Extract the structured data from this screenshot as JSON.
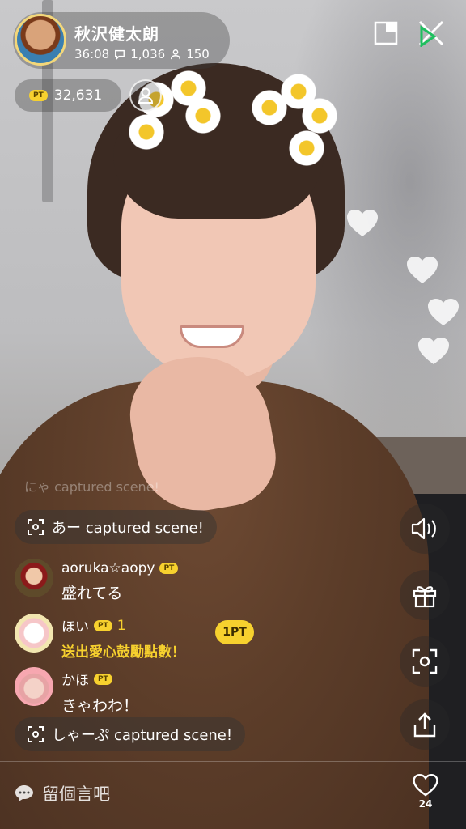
{
  "host": {
    "name": "秋沢健太朗",
    "duration": "36:08",
    "comment_count": "1,036",
    "viewer_count": "150"
  },
  "points": {
    "badge": "PT",
    "value": "32,631"
  },
  "scene_captures": [
    {
      "text": "あー captured scene!"
    },
    {
      "text": "しゃーぷ captured scene!"
    }
  ],
  "faded_message": "にゃ captured scene!",
  "comments": [
    {
      "user": "aoruka☆aopy",
      "badge": "PT",
      "count": "",
      "text": "盛れてる"
    },
    {
      "user": "ほい",
      "badge": "PT",
      "count": "1",
      "text": "送出愛心鼓勵點數！"
    },
    {
      "user": "かほ",
      "badge": "PT",
      "count": "",
      "text": "きゃわわ！"
    }
  ],
  "gift_tag": "1PT",
  "input": {
    "placeholder": "留個言吧"
  },
  "likes": {
    "count": "24"
  },
  "colors": {
    "accent_yellow": "#f7d12e",
    "brand_green": "#1fbf5f"
  },
  "icons": {
    "pip": "picture-in-picture-icon",
    "close": "close-icon",
    "follow": "person-icon",
    "sound": "speaker-icon",
    "gift": "gift-icon",
    "capture": "capture-icon",
    "share": "share-icon",
    "like": "heart-icon",
    "chat": "chat-bubble-icon"
  }
}
